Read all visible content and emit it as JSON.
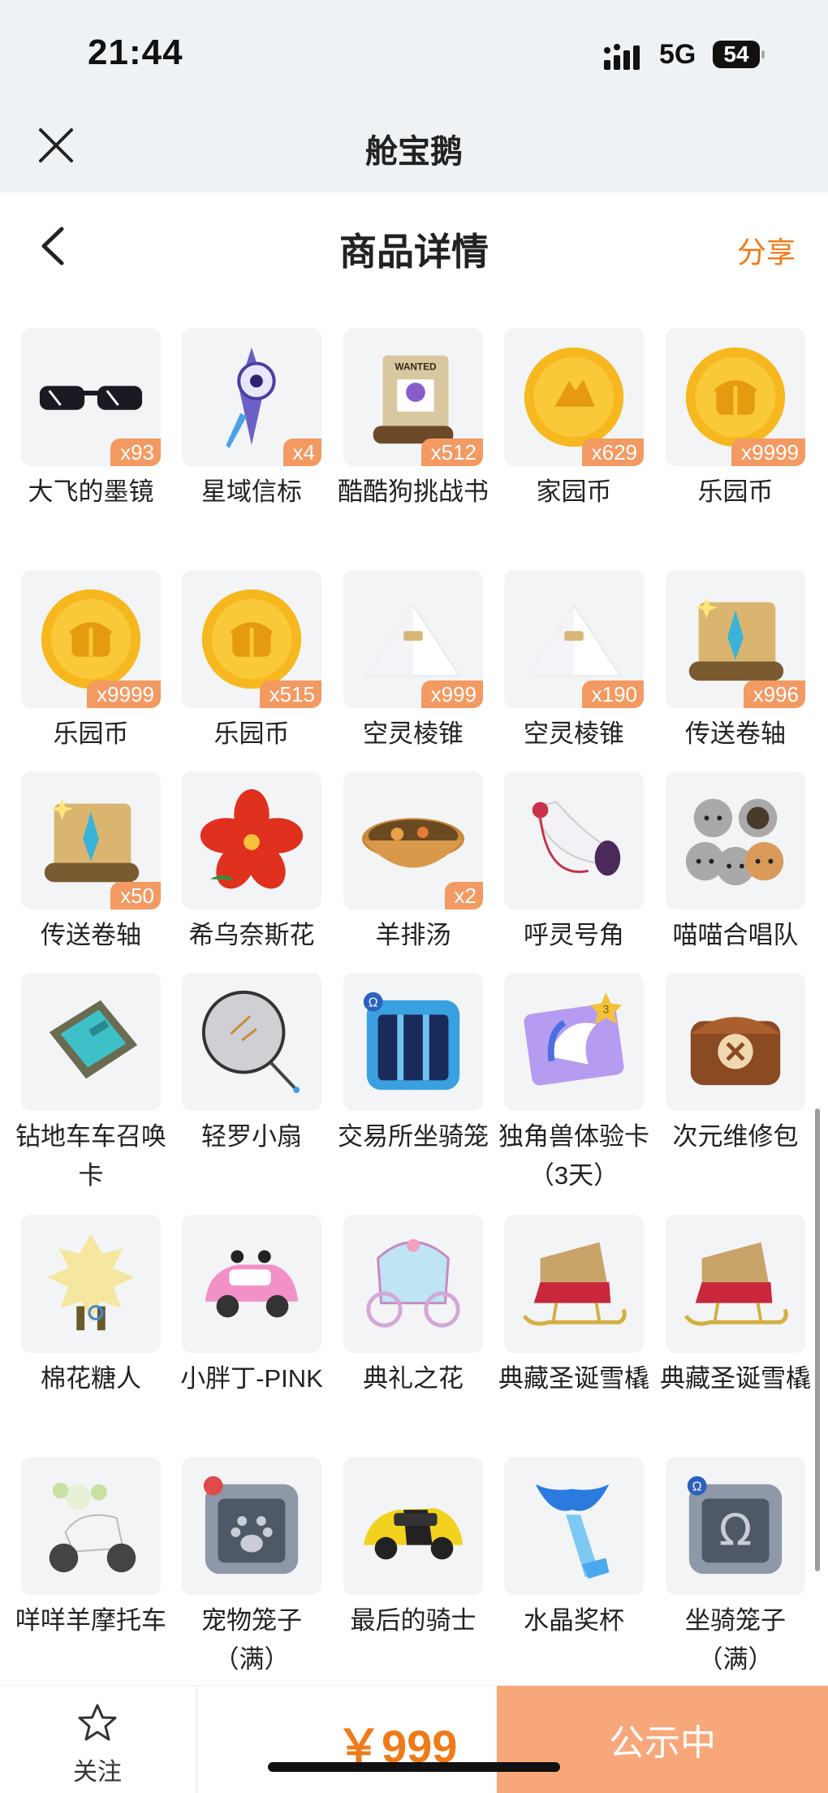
{
  "status": {
    "time": "21:44",
    "network": "5G",
    "battery": "54"
  },
  "appbar": {
    "title": "舱宝鹅"
  },
  "header": {
    "title": "商品详情",
    "share": "分享"
  },
  "items": [
    {
      "name": "大飞的墨镜",
      "qty": "x93",
      "icon": "sunglasses-icon"
    },
    {
      "name": "星域信标",
      "qty": "x4",
      "icon": "star-beacon-icon"
    },
    {
      "name": "酷酷狗挑战书",
      "qty": "x512",
      "icon": "wanted-scroll-icon"
    },
    {
      "name": "家园币",
      "qty": "x629",
      "icon": "home-coin-icon"
    },
    {
      "name": "乐园币",
      "qty": "x9999",
      "icon": "park-coin-icon"
    },
    {
      "name": "乐园币",
      "qty": "x9999",
      "icon": "park-coin-icon"
    },
    {
      "name": "乐园币",
      "qty": "x515",
      "icon": "park-coin-icon"
    },
    {
      "name": "空灵棱锥",
      "qty": "x999",
      "icon": "pyramid-icon"
    },
    {
      "name": "空灵棱锥",
      "qty": "x190",
      "icon": "pyramid-icon"
    },
    {
      "name": "传送卷轴",
      "qty": "x996",
      "icon": "teleport-scroll-icon"
    },
    {
      "name": "传送卷轴",
      "qty": "x50",
      "icon": "teleport-scroll-icon"
    },
    {
      "name": "希乌奈斯花",
      "qty": "",
      "icon": "red-flower-icon"
    },
    {
      "name": "羊排汤",
      "qty": "x2",
      "icon": "soup-bowl-icon"
    },
    {
      "name": "呼灵号角",
      "qty": "",
      "icon": "horn-icon"
    },
    {
      "name": "喵喵合唱队",
      "qty": "",
      "icon": "cats-icon"
    },
    {
      "name": "钻地车车召唤卡",
      "qty": "",
      "icon": "drill-card-icon"
    },
    {
      "name": "轻罗小扇",
      "qty": "",
      "icon": "fan-icon"
    },
    {
      "name": "交易所坐骑笼",
      "qty": "",
      "icon": "mount-cage-icon"
    },
    {
      "name": "独角兽体验卡（3天）",
      "qty": "",
      "icon": "unicorn-card-icon"
    },
    {
      "name": "次元维修包",
      "qty": "",
      "icon": "repair-bag-icon"
    },
    {
      "name": "棉花糖人",
      "qty": "",
      "icon": "marshmallow-man-icon"
    },
    {
      "name": "小胖丁-PINK",
      "qty": "",
      "icon": "pink-car-icon"
    },
    {
      "name": "典礼之花",
      "qty": "",
      "icon": "carriage-icon"
    },
    {
      "name": "典藏圣诞雪橇",
      "qty": "",
      "icon": "sleigh-icon"
    },
    {
      "name": "典藏圣诞雪橇",
      "qty": "",
      "icon": "sleigh-icon"
    },
    {
      "name": "咩咩羊摩托车",
      "qty": "",
      "icon": "scooter-icon"
    },
    {
      "name": "宠物笼子（满）",
      "qty": "",
      "icon": "pet-cage-icon"
    },
    {
      "name": "最后的骑士",
      "qty": "",
      "icon": "yellow-car-icon"
    },
    {
      "name": "水晶奖杯",
      "qty": "",
      "icon": "crystal-trophy-icon"
    },
    {
      "name": "坐骑笼子（满）",
      "qty": "",
      "icon": "mount-cage-full-icon"
    }
  ],
  "bottom": {
    "follow": "关注",
    "price": "￥999",
    "cta": "公示中"
  }
}
